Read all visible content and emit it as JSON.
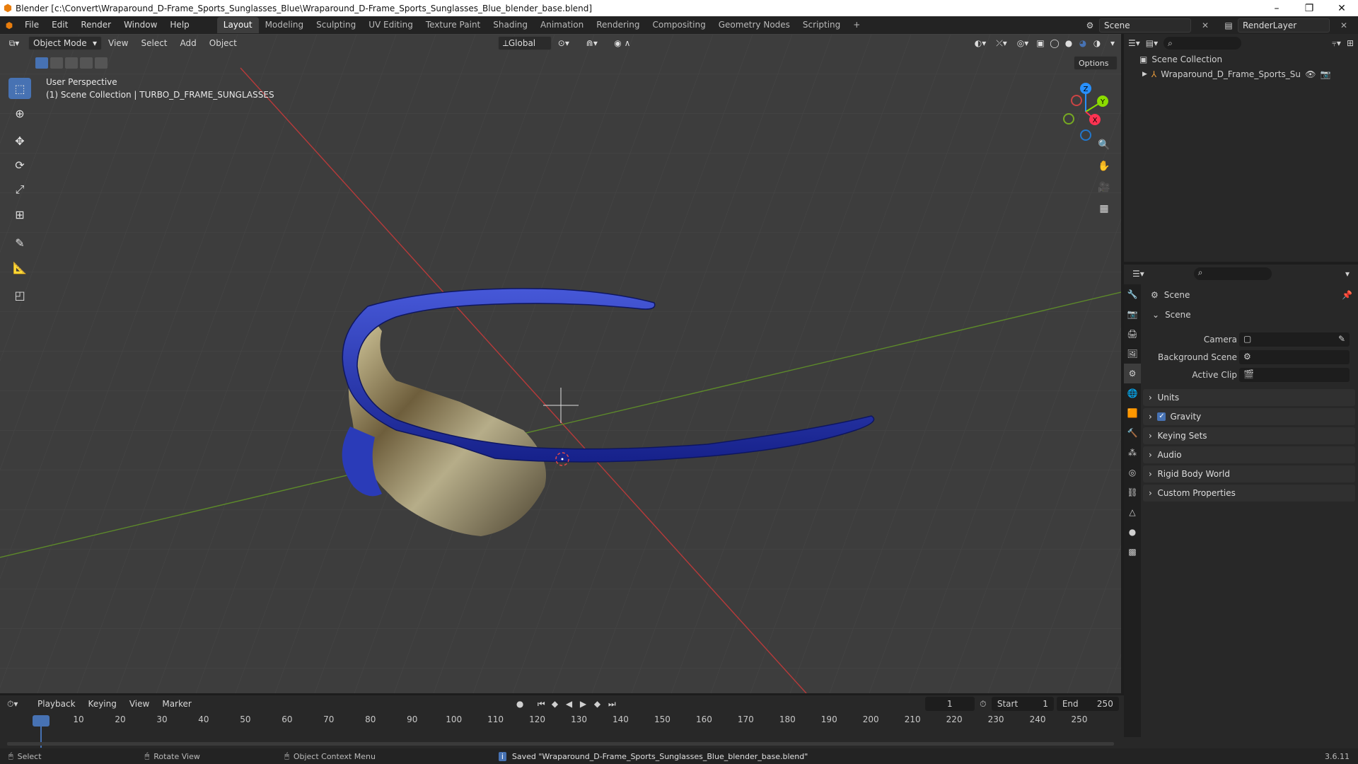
{
  "window": {
    "title": "Blender [c:\\Convert\\Wraparound_D-Frame_Sports_Sunglasses_Blue\\Wraparound_D-Frame_Sports_Sunglasses_Blue_blender_base.blend]",
    "minimize": "–",
    "maximize": "❐",
    "close": "✕"
  },
  "menus": [
    "File",
    "Edit",
    "Render",
    "Window",
    "Help"
  ],
  "workspaces": [
    "Layout",
    "Modeling",
    "Sculpting",
    "UV Editing",
    "Texture Paint",
    "Shading",
    "Animation",
    "Rendering",
    "Compositing",
    "Geometry Nodes",
    "Scripting",
    "+"
  ],
  "scene_name": "Scene",
  "render_layer": "RenderLayer",
  "viewport": {
    "mode": "Object Mode",
    "menus": [
      "View",
      "Select",
      "Add",
      "Object"
    ],
    "orientation": "Global",
    "options": "Options",
    "info_line1": "User Perspective",
    "info_line2": "(1) Scene Collection | TURBO_D_FRAME_SUNGLASSES",
    "gizmo_z": "Z",
    "gizmo_y": "Y",
    "gizmo_x": "X"
  },
  "tools": [
    "select-box-icon",
    "cursor-icon",
    "move-icon",
    "rotate-icon",
    "scale-icon",
    "transform-icon",
    "annotate-icon",
    "measure-icon",
    "add-cube-icon"
  ],
  "outliner": {
    "collection": "Scene Collection",
    "object": "Wraparound_D_Frame_Sports_Sunglasses"
  },
  "properties": {
    "header": "Scene",
    "section": "Scene",
    "camera_label": "Camera",
    "background_label": "Background Scene",
    "clip_label": "Active Clip",
    "panels": [
      "Units",
      "Gravity",
      "Keying Sets",
      "Audio",
      "Rigid Body World",
      "Custom Properties"
    ],
    "gravity_checked": true
  },
  "timeline": {
    "menus": [
      "Playback",
      "Keying",
      "View",
      "Marker"
    ],
    "current_frame": "1",
    "start_label": "Start",
    "start": "1",
    "end_label": "End",
    "end": "250",
    "ticks": [
      "1",
      "10",
      "20",
      "30",
      "40",
      "50",
      "60",
      "70",
      "80",
      "90",
      "100",
      "110",
      "120",
      "130",
      "140",
      "150",
      "160",
      "170",
      "180",
      "190",
      "200",
      "210",
      "220",
      "230",
      "240",
      "250"
    ]
  },
  "status": {
    "select": "Select",
    "rotate": "Rotate View",
    "context": "Object Context Menu",
    "message": "Saved \"Wraparound_D-Frame_Sports_Sunglasses_Blue_blender_base.blend\"",
    "version": "3.6.11"
  },
  "colors": {
    "accent": "#4772b3",
    "frame": "#1e2f9c",
    "x_axis": "#ff3352",
    "y_axis": "#8bdc00",
    "z_axis": "#2890ff"
  }
}
